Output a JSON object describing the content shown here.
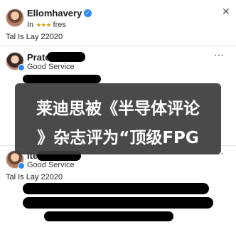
{
  "card1": {
    "name": "Ellomhavery",
    "sub_prefix": "In",
    "stars": "★★★",
    "sub_suffix": "fres",
    "meta": "Tal Is Lay 22020",
    "close": "✕"
  },
  "card2": {
    "name": "Prate",
    "sub": "Good Service",
    "more": "⋯"
  },
  "card3": {
    "name": "Ite",
    "sub": "Good Service",
    "meta": "Tal Is Lay 22020",
    "more": "⋯"
  },
  "overlay": {
    "line1": "莱迪思被《半导体评论",
    "line2": "》杂志评为“顶级FPG"
  }
}
